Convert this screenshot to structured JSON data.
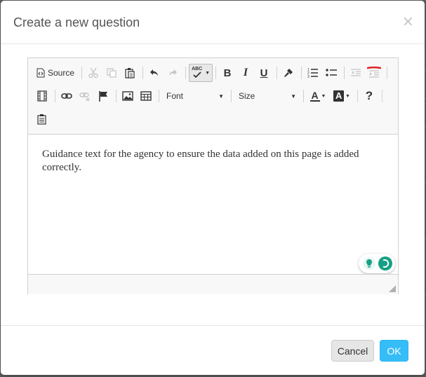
{
  "dialog": {
    "title": "Create a new question",
    "close_label": "×"
  },
  "toolbar": {
    "source_label": "Source",
    "font_label": "Font",
    "size_label": "Size",
    "help_label": "?",
    "bold_label": "B",
    "italic_label": "I",
    "underline_label": "U",
    "spellcheck_label": "ABC",
    "text_color_label": "A",
    "bg_color_label": "A",
    "icons": [
      "source-icon",
      "cut-icon",
      "copy-icon",
      "paste-icon",
      "undo-icon",
      "redo-icon",
      "spellcheck-icon",
      "bold-icon",
      "italic-icon",
      "underline-icon",
      "format-painter-icon",
      "numbered-list-icon",
      "bulleted-list-icon",
      "decrease-indent-icon",
      "increase-indent-icon",
      "video-icon",
      "link-icon",
      "unlink-icon",
      "anchor-flag-icon",
      "image-icon",
      "table-icon",
      "text-color-icon",
      "background-color-icon",
      "help-icon",
      "paste-from-word-icon"
    ]
  },
  "editor": {
    "content": "Guidance text for the agency to ensure the data added on this page is added correctly."
  },
  "footer": {
    "cancel_label": "Cancel",
    "ok_label": "OK"
  },
  "colors": {
    "ok_button": "#36bdf7",
    "grammar_green": "#15a085",
    "indent_red_mark": "#e02020"
  }
}
